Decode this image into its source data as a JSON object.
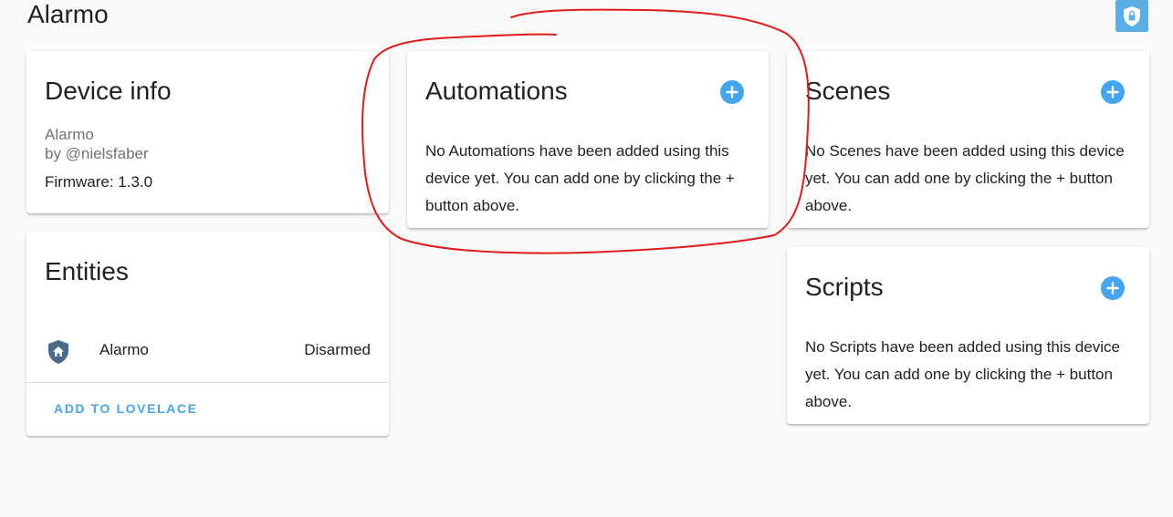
{
  "page": {
    "title": "Alarmo"
  },
  "header": {
    "badge_icon": "shield-lock-icon",
    "badge_color": "#5ab0e6"
  },
  "device_info": {
    "title": "Device info",
    "model": "Alarmo",
    "manufacturer": "by @nielsfaber",
    "firmware": "Firmware: 1.3.0"
  },
  "entities": {
    "title": "Entities",
    "items": [
      {
        "name": "Alarmo",
        "state": "Disarmed",
        "icon": "shield-home-icon"
      }
    ],
    "add_button": "ADD TO LOVELACE"
  },
  "automations": {
    "title": "Automations",
    "lines": [
      "No Automations have been added using this",
      "device yet. You can add one by clicking the +",
      "button above."
    ]
  },
  "scenes": {
    "title": "Scenes",
    "lines": [
      "No Scenes have been added using this device",
      "yet. You can add one by clicking the + button",
      "above."
    ]
  },
  "scripts": {
    "title": "Scripts",
    "lines": [
      "No Scripts have been added using this device",
      "yet. You can add one by clicking the + button",
      "above."
    ]
  },
  "colors": {
    "accent": "#43a5f0",
    "annotation": "#e11b1b",
    "entity_icon": "#4a6a8a"
  }
}
